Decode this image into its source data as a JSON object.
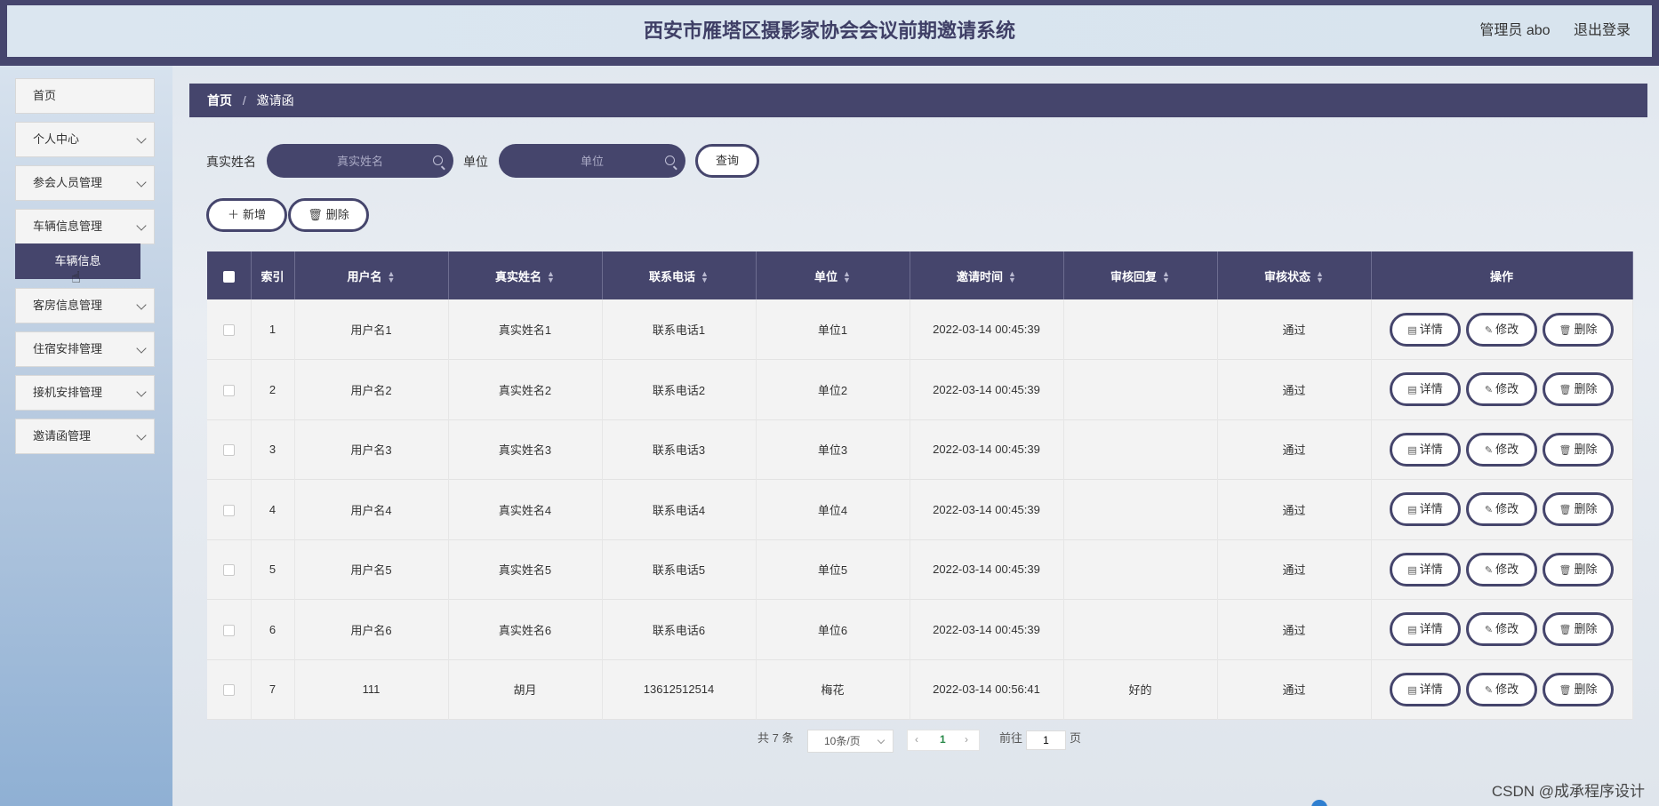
{
  "header": {
    "title": "西安市雁塔区摄影家协会会议前期邀请系统",
    "user_label": "管理员 abo",
    "logout_label": "退出登录"
  },
  "sidebar": {
    "items": [
      {
        "label": "首页"
      },
      {
        "label": "个人中心"
      },
      {
        "label": "参会人员管理"
      },
      {
        "label": "车辆信息管理"
      },
      {
        "label": "客房信息管理"
      },
      {
        "label": "住宿安排管理"
      },
      {
        "label": "接机安排管理"
      },
      {
        "label": "邀请函管理"
      }
    ],
    "sub_item": "车辆信息"
  },
  "breadcrumb": {
    "home": "首页",
    "separator": "/",
    "current": "邀请函"
  },
  "search": {
    "name_label": "真实姓名",
    "name_placeholder": "真实姓名",
    "unit_label": "单位",
    "unit_placeholder": "单位",
    "query_button": "查询"
  },
  "actions": {
    "add_label": "新增",
    "delete_label": "删除"
  },
  "table": {
    "headers": [
      "索引",
      "用户名",
      "真实姓名",
      "联系电话",
      "单位",
      "邀请时间",
      "审核回复",
      "审核状态",
      "操作"
    ],
    "row_buttons": {
      "detail": "详情",
      "edit": "修改",
      "delete": "删除"
    },
    "rows": [
      {
        "index": "1",
        "username": "用户名1",
        "realname": "真实姓名1",
        "phone": "联系电话1",
        "unit": "单位1",
        "time": "2022-03-14 00:45:39",
        "reply": "",
        "status": "通过"
      },
      {
        "index": "2",
        "username": "用户名2",
        "realname": "真实姓名2",
        "phone": "联系电话2",
        "unit": "单位2",
        "time": "2022-03-14 00:45:39",
        "reply": "",
        "status": "通过"
      },
      {
        "index": "3",
        "username": "用户名3",
        "realname": "真实姓名3",
        "phone": "联系电话3",
        "unit": "单位3",
        "time": "2022-03-14 00:45:39",
        "reply": "",
        "status": "通过"
      },
      {
        "index": "4",
        "username": "用户名4",
        "realname": "真实姓名4",
        "phone": "联系电话4",
        "unit": "单位4",
        "time": "2022-03-14 00:45:39",
        "reply": "",
        "status": "通过"
      },
      {
        "index": "5",
        "username": "用户名5",
        "realname": "真实姓名5",
        "phone": "联系电话5",
        "unit": "单位5",
        "time": "2022-03-14 00:45:39",
        "reply": "",
        "status": "通过"
      },
      {
        "index": "6",
        "username": "用户名6",
        "realname": "真实姓名6",
        "phone": "联系电话6",
        "unit": "单位6",
        "time": "2022-03-14 00:45:39",
        "reply": "",
        "status": "通过"
      },
      {
        "index": "7",
        "username": "111",
        "realname": "胡月",
        "phone": "13612512514",
        "unit": "梅花",
        "time": "2022-03-14 00:56:41",
        "reply": "好的",
        "status": "通过"
      }
    ]
  },
  "pagination": {
    "total": "共 7 条",
    "page_size": "10条/页",
    "prev": "‹",
    "current_page": "1",
    "next": "›",
    "goto_label": "前往",
    "goto_value": "1",
    "page_suffix": "页"
  },
  "watermark": "CSDN @成承程序设计",
  "colors": {
    "primary": "#45456c",
    "current_page": "#2a8a4a"
  }
}
